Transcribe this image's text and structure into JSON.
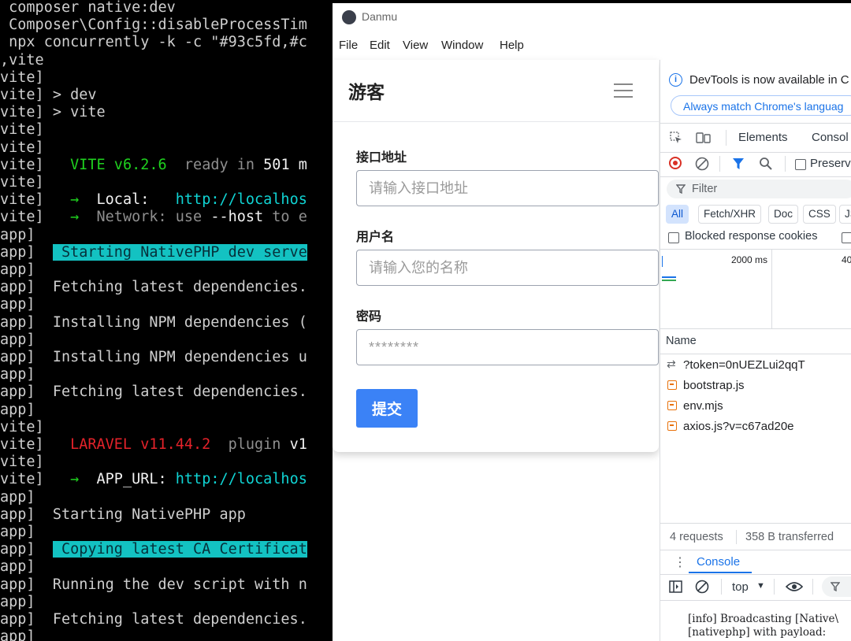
{
  "terminal": {
    "lines": [
      {
        "prefix": " composer native:dev",
        "text": "",
        "style": "plain"
      },
      {
        "prefix": " Composer\\Config::disableProcessTim",
        "text": "",
        "style": "plain"
      },
      {
        "prefix": " npx concurrently -k -c \"#93c5fd,#c",
        "text": "",
        "style": "plain"
      },
      {
        "prefix": ",vite",
        "text": "",
        "style": "plain"
      },
      {
        "prefix": "vite]",
        "text": "",
        "style": "plain"
      },
      {
        "prefix": "vite] ",
        "text": "> dev",
        "style": "plain"
      },
      {
        "prefix": "vite] ",
        "text": "> vite",
        "style": "plain"
      },
      {
        "prefix": "vite]",
        "text": "",
        "style": "plain"
      },
      {
        "prefix": "vite]",
        "text": "",
        "style": "plain"
      },
      {
        "prefix": "vite]   ",
        "text": "VITE v6.2.6  ready in 501 m",
        "style": "vite"
      },
      {
        "prefix": "vite]",
        "text": "",
        "style": "plain"
      },
      {
        "prefix": "vite]   ",
        "text": "→  Local:   http://localhos",
        "style": "local"
      },
      {
        "prefix": "vite]   ",
        "text": "→  Network: use --host to e",
        "style": "network"
      },
      {
        "prefix": "app]",
        "text": "",
        "style": "plain"
      },
      {
        "prefix": "app]  ",
        "text": " Starting NativePHP dev serve",
        "style": "bar"
      },
      {
        "prefix": "app]",
        "text": "",
        "style": "plain"
      },
      {
        "prefix": "app]  ",
        "text": "Fetching latest dependencies.",
        "style": "plain"
      },
      {
        "prefix": "app]",
        "text": "",
        "style": "plain"
      },
      {
        "prefix": "app]  ",
        "text": "Installing NPM dependencies (",
        "style": "plain"
      },
      {
        "prefix": "app]",
        "text": "",
        "style": "plain"
      },
      {
        "prefix": "app]  ",
        "text": "Installing NPM dependencies u",
        "style": "plain"
      },
      {
        "prefix": "app]",
        "text": "",
        "style": "plain"
      },
      {
        "prefix": "app]  ",
        "text": "Fetching latest dependencies.",
        "style": "plain"
      },
      {
        "prefix": "app]",
        "text": "",
        "style": "plain"
      },
      {
        "prefix": "vite]",
        "text": "",
        "style": "plain"
      },
      {
        "prefix": "vite]   ",
        "text": "LARAVEL v11.44.2  plugin v1",
        "style": "laravel"
      },
      {
        "prefix": "vite]",
        "text": "",
        "style": "plain"
      },
      {
        "prefix": "vite]   ",
        "text": "→  APP_URL: http://localhos",
        "style": "appurl"
      },
      {
        "prefix": "app]",
        "text": "",
        "style": "plain"
      },
      {
        "prefix": "app]  ",
        "text": "Starting NativePHP app",
        "style": "plain"
      },
      {
        "prefix": "app]",
        "text": "",
        "style": "plain"
      },
      {
        "prefix": "app]  ",
        "text": " Copying latest CA Certificat",
        "style": "bar"
      },
      {
        "prefix": "app]",
        "text": "",
        "style": "plain"
      },
      {
        "prefix": "app]  ",
        "text": "Running the dev script with n",
        "style": "plain"
      },
      {
        "prefix": "app]",
        "text": "",
        "style": "plain"
      },
      {
        "prefix": "app]  ",
        "text": "Fetching latest dependencies.",
        "style": "plain"
      },
      {
        "prefix": "app]",
        "text": "",
        "style": "plain"
      }
    ]
  },
  "window": {
    "title": "Danmu",
    "menu": [
      "File",
      "Edit",
      "View",
      "Window",
      "Help"
    ]
  },
  "app": {
    "header_title": "游客",
    "fields": [
      {
        "label": "接口地址",
        "placeholder": "请输入接口地址",
        "value": ""
      },
      {
        "label": "用户名",
        "placeholder": "请输入您的名称",
        "value": ""
      },
      {
        "label": "密码",
        "placeholder": "********",
        "value": ""
      }
    ],
    "submit_label": "提交",
    "accent_color": "#3b82f6"
  },
  "devtools": {
    "info_text": "DevTools is now available in C",
    "always_match_label": "Always match Chrome's languag",
    "tabs": [
      "Elements",
      "Consol"
    ],
    "preserve_label": "Preserv",
    "filter_placeholder": "Filter",
    "type_filters": [
      "All",
      "Fetch/XHR",
      "Doc",
      "CSS",
      "JS"
    ],
    "blocked_label": "Blocked response cookies",
    "timeline_ticks": [
      "2000 ms",
      "40"
    ],
    "name_header": "Name",
    "requests": [
      {
        "name": "?token=0nUEZLui2qqT",
        "icon": "websocket-icon"
      },
      {
        "name": "bootstrap.js",
        "icon": "script-icon"
      },
      {
        "name": "env.mjs",
        "icon": "script-icon"
      },
      {
        "name": "axios.js?v=c67ad20e",
        "icon": "script-icon"
      }
    ],
    "status": {
      "requests": "4 requests",
      "transferred": "358 B transferred"
    },
    "drawer_tab": "Console",
    "context": "top",
    "console_lines": [
      "[info] Broadcasting [Native\\",
      "[nativephp] with payload:"
    ]
  }
}
